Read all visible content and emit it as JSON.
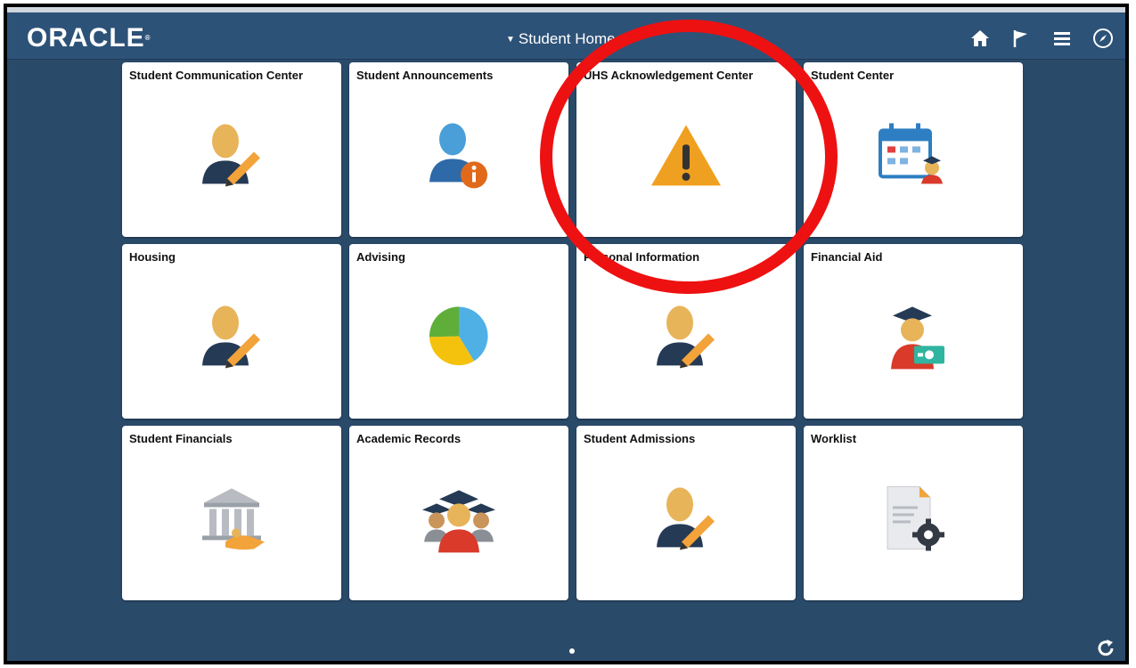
{
  "header": {
    "logo_text": "ORACLE",
    "homepage_label": "Student Home",
    "icons": [
      "home-icon",
      "flag-icon",
      "menu-icon",
      "navbar-compass-icon"
    ]
  },
  "tiles": [
    {
      "title": "Student Communication Center",
      "icon": "person-pencil-icon"
    },
    {
      "title": "Student Announcements",
      "icon": "person-info-icon"
    },
    {
      "title": "UHS Acknowledgement Center",
      "icon": "warning-icon"
    },
    {
      "title": "Student Center",
      "icon": "calendar-student-icon"
    },
    {
      "title": "Housing",
      "icon": "person-pencil-icon"
    },
    {
      "title": "Advising",
      "icon": "pie-chart-icon"
    },
    {
      "title": "Personal Information",
      "icon": "person-pencil-icon"
    },
    {
      "title": "Financial Aid",
      "icon": "graduate-money-icon"
    },
    {
      "title": "Student Financials",
      "icon": "bank-icon"
    },
    {
      "title": "Academic Records",
      "icon": "graduates-icon"
    },
    {
      "title": "Student Admissions",
      "icon": "person-pencil-icon"
    },
    {
      "title": "Worklist",
      "icon": "document-gear-icon"
    }
  ],
  "footer": {
    "refresh_icon": "refresh-icon"
  },
  "colors": {
    "topbar": "#2d5278",
    "background": "#2a4a6a",
    "highlight": "#ee1111",
    "warning": "#f0a020"
  }
}
